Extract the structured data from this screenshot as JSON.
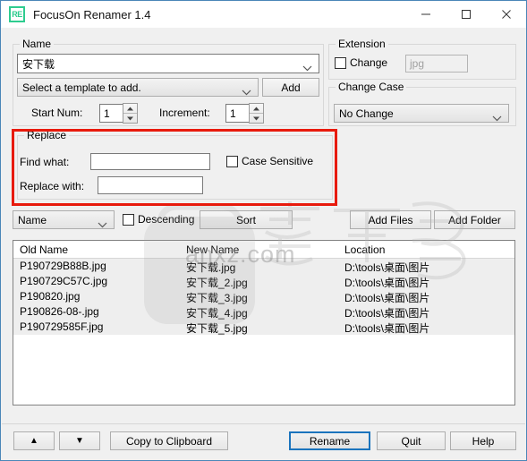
{
  "window": {
    "title": "FocusOn Renamer 1.4",
    "app_icon_label": "RE",
    "accent_color": "#2ecc8f",
    "controls": {
      "minimize": "minimize-icon",
      "maximize": "maximize-icon",
      "close": "close-icon"
    }
  },
  "name_group": {
    "legend": "Name",
    "name_value": "安下载",
    "template_value": "Select a template to add.",
    "add_button": "Add",
    "start_num_label": "Start Num:",
    "start_num_value": "1",
    "increment_label": "Increment:",
    "increment_value": "1"
  },
  "extension_group": {
    "legend": "Extension",
    "change_label": "Change",
    "change_checked": false,
    "extension_value": "jpg"
  },
  "change_case_group": {
    "legend": "Change Case",
    "selected": "No Change"
  },
  "replace_group": {
    "legend": "Replace",
    "find_label": "Find what:",
    "find_value": "",
    "replace_label": "Replace with:",
    "replace_value": "",
    "case_sensitive_label": "Case Sensitive",
    "case_sensitive_checked": false,
    "highlight_color": "#e81a0c"
  },
  "toolbar": {
    "sort_field": "Name",
    "descending_label": "Descending",
    "descending_checked": false,
    "sort_button": "Sort",
    "add_files_button": "Add Files",
    "add_folder_button": "Add Folder"
  },
  "list": {
    "columns": [
      "Old Name",
      "New Name",
      "Location"
    ],
    "rows": [
      {
        "old_name": "P190729B88B.jpg",
        "new_name": "安下载.jpg",
        "location": "D:\\tools\\桌面\\图片"
      },
      {
        "old_name": "P190729C57C.jpg",
        "new_name": "安下载_2.jpg",
        "location": "D:\\tools\\桌面\\图片"
      },
      {
        "old_name": "P190820.jpg",
        "new_name": "安下载_3.jpg",
        "location": "D:\\tools\\桌面\\图片"
      },
      {
        "old_name": "P190826-08-.jpg",
        "new_name": "安下载_4.jpg",
        "location": "D:\\tools\\桌面\\图片"
      },
      {
        "old_name": "P190729585F.jpg",
        "new_name": "安下载_5.jpg",
        "location": "D:\\tools\\桌面\\图片"
      }
    ]
  },
  "footer": {
    "move_up": "▲",
    "move_down": "▼",
    "copy_clipboard": "Copy to Clipboard",
    "rename": "Rename",
    "quit": "Quit",
    "help": "Help"
  },
  "watermark": {
    "site": "anxz.com",
    "glyphs": "安下载"
  }
}
